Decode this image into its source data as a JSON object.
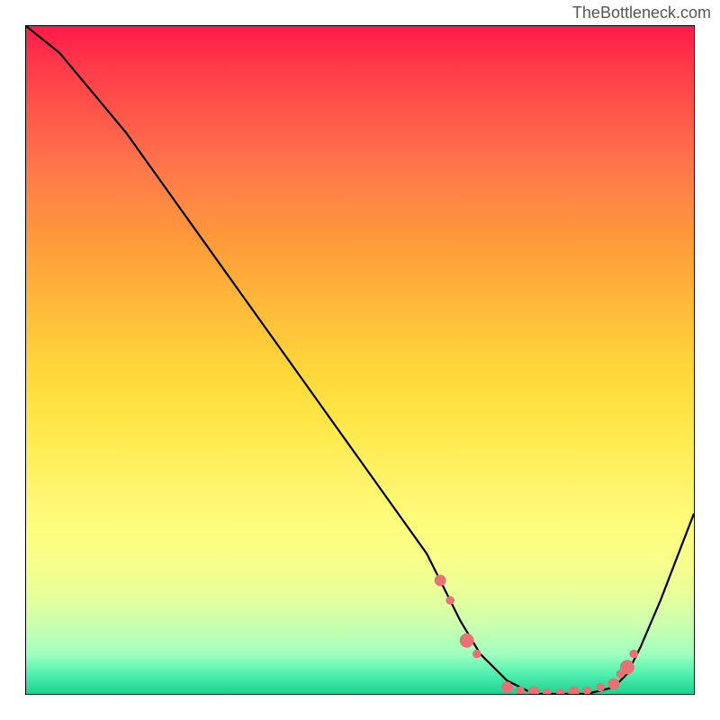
{
  "watermark": "TheBottleneck.com",
  "chart_data": {
    "type": "line",
    "title": "",
    "xlabel": "",
    "ylabel": "",
    "xlim": [
      0,
      100
    ],
    "ylim": [
      0,
      100
    ],
    "series": [
      {
        "name": "bottleneck-curve",
        "x": [
          0,
          5,
          10,
          15,
          20,
          25,
          30,
          35,
          40,
          45,
          50,
          55,
          60,
          62,
          65,
          68,
          72,
          76,
          80,
          84,
          88,
          90,
          92,
          95,
          100
        ],
        "y": [
          100,
          96,
          90,
          84,
          77,
          70,
          63,
          56,
          49,
          42,
          35,
          28,
          21,
          17,
          11,
          6,
          2,
          0,
          0,
          0,
          1,
          3,
          7,
          14,
          27
        ]
      }
    ],
    "markers": {
      "name": "highlight-points",
      "color": "#e57373",
      "points": [
        {
          "x": 62,
          "y": 17,
          "r": 4
        },
        {
          "x": 63.5,
          "y": 14,
          "r": 3
        },
        {
          "x": 66,
          "y": 8,
          "r": 5
        },
        {
          "x": 67.5,
          "y": 6,
          "r": 3
        },
        {
          "x": 72,
          "y": 1,
          "r": 4
        },
        {
          "x": 74,
          "y": 0.5,
          "r": 3
        },
        {
          "x": 76,
          "y": 0.3,
          "r": 4
        },
        {
          "x": 78,
          "y": 0.2,
          "r": 3
        },
        {
          "x": 80,
          "y": 0.2,
          "r": 3
        },
        {
          "x": 82,
          "y": 0.3,
          "r": 4
        },
        {
          "x": 84,
          "y": 0.5,
          "r": 3
        },
        {
          "x": 86,
          "y": 1,
          "r": 3
        },
        {
          "x": 88,
          "y": 1.5,
          "r": 4
        },
        {
          "x": 89,
          "y": 3,
          "r": 3
        },
        {
          "x": 90,
          "y": 4,
          "r": 5
        },
        {
          "x": 91,
          "y": 6,
          "r": 3
        }
      ]
    },
    "background_gradient": {
      "top": "#ff1a4a",
      "mid": "#ffe84a",
      "bottom": "#20d090"
    }
  }
}
